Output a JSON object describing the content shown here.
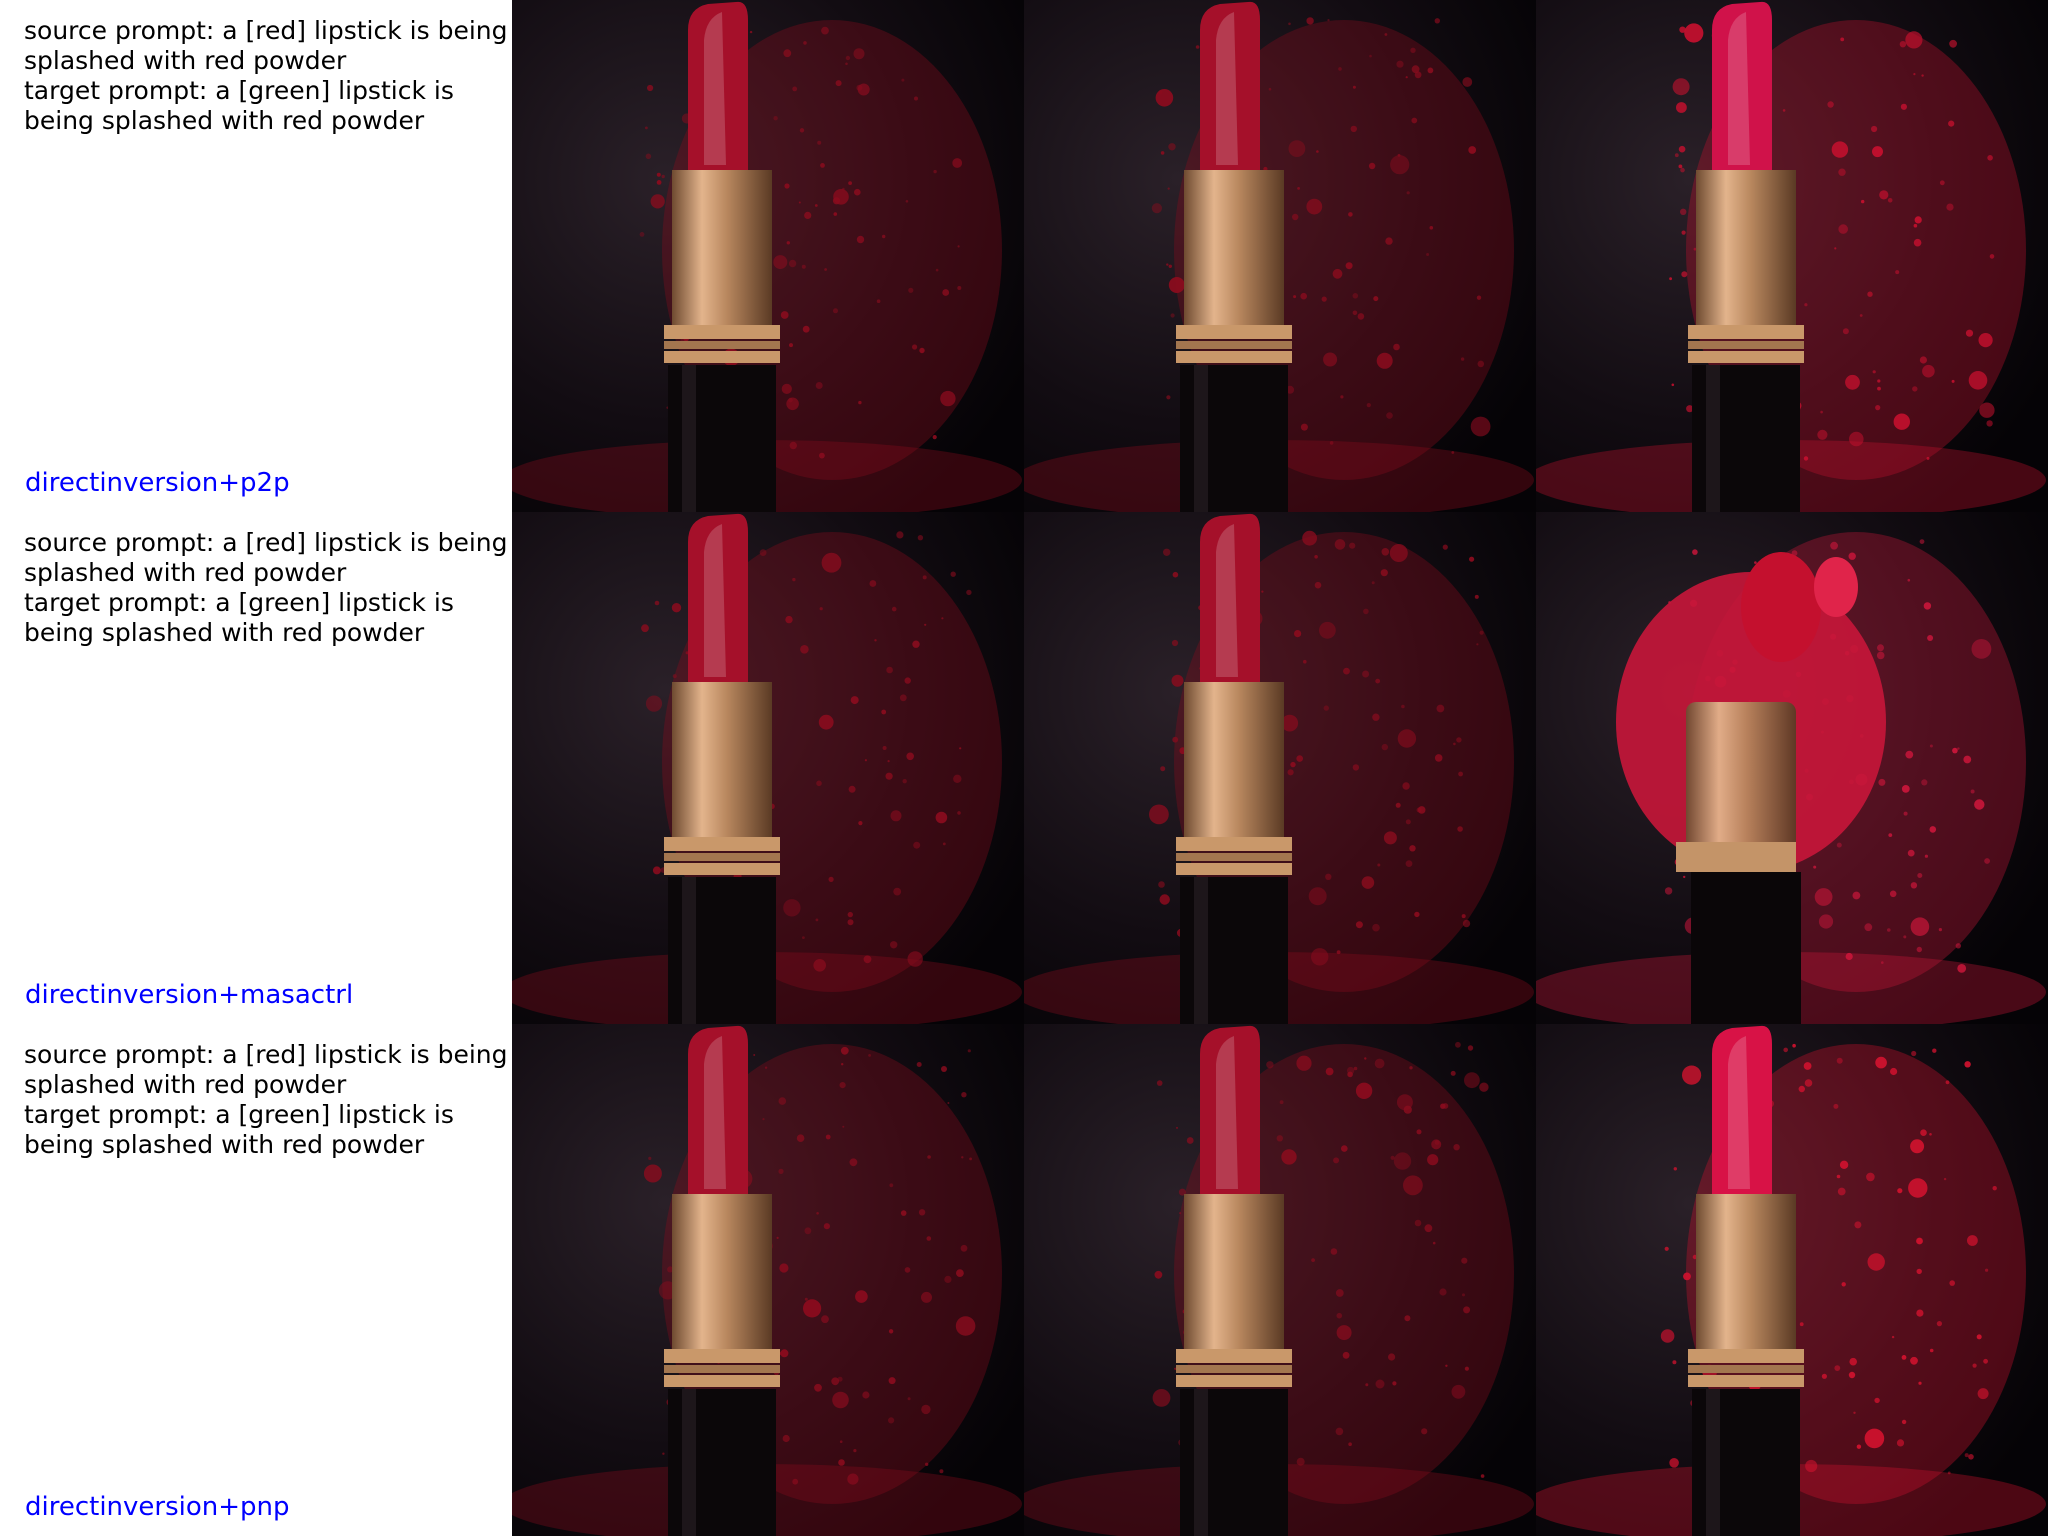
{
  "rows": [
    {
      "source_prompt_line1": "source prompt: a [red] lipstick is being",
      "source_prompt_line2": "splashed with red powder",
      "target_prompt_line1": "target prompt: a [green] lipstick is",
      "target_prompt_line2": "being splashed with red powder",
      "method": "directinversion+p2p",
      "images": [
        {
          "variant": "source",
          "bullet_color": "#a5102a",
          "powder_color": "#8a0c1e"
        },
        {
          "variant": "source",
          "bullet_color": "#a5102a",
          "powder_color": "#8a0c1e"
        },
        {
          "variant": "edited",
          "bullet_color": "#d0124a",
          "powder_color": "#c4102e"
        }
      ]
    },
    {
      "source_prompt_line1": "source prompt: a [red] lipstick is being",
      "source_prompt_line2": "splashed with red powder",
      "target_prompt_line1": "target prompt: a [green] lipstick is",
      "target_prompt_line2": "being splashed with red powder",
      "method": "directinversion+masactrl",
      "images": [
        {
          "variant": "source",
          "bullet_color": "#a5102a",
          "powder_color": "#8a0c1e"
        },
        {
          "variant": "source",
          "bullet_color": "#a5102a",
          "powder_color": "#8a0c1e"
        },
        {
          "variant": "crumbled",
          "bullet_color": "#c4102e",
          "powder_color": "#c8163a"
        }
      ]
    },
    {
      "source_prompt_line1": "source prompt: a [red] lipstick is being",
      "source_prompt_line2": "splashed with red powder",
      "target_prompt_line1": "target prompt: a [green] lipstick is",
      "target_prompt_line2": "being splashed with red powder",
      "method": "directinversion+pnp",
      "images": [
        {
          "variant": "source",
          "bullet_color": "#a5102a",
          "powder_color": "#8a0c1e"
        },
        {
          "variant": "source",
          "bullet_color": "#a5102a",
          "powder_color": "#8a0c1e"
        },
        {
          "variant": "edited",
          "bullet_color": "#d81246",
          "powder_color": "#d0122e"
        }
      ]
    }
  ]
}
